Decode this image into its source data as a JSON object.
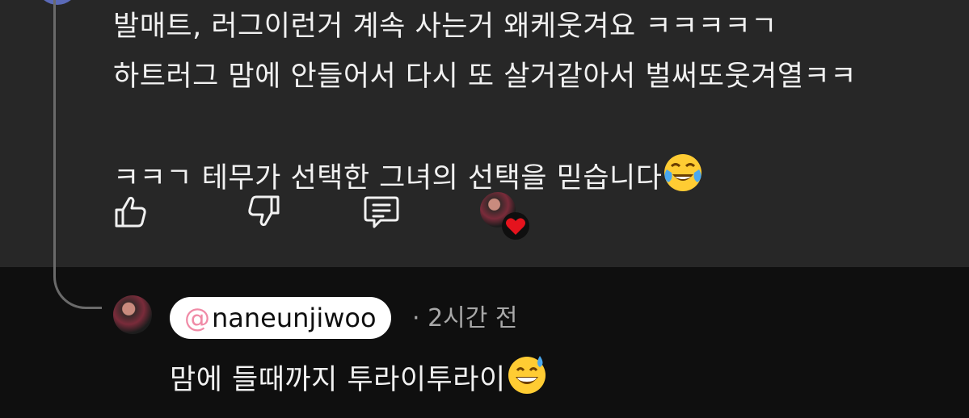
{
  "comment": {
    "lines": [
      "발매트, 러그이런거 계속 사는거 왜케웃겨요 ㅋㅋㅋㅋㄱ",
      "하트러그 맘에 안들어서 다시 또 살거같아서 벌써또웃겨열ㅋㅋ",
      "ㅋㅋㄱ 테무가 선택한 그녀의 선택을 믿습니다"
    ],
    "end_emoji": "face-with-tears-of-joy"
  },
  "actions": {
    "like_icon": "thumbs-up-icon",
    "dislike_icon": "thumbs-down-icon",
    "reply_icon": "comment-icon",
    "creator_heart": "creator-heart-avatar"
  },
  "reply": {
    "mention_handle": "naneunjiwoo",
    "mention_at": "@",
    "meta": "· 2시간 전",
    "text": "맘에 들때까지 투라이투라이",
    "end_emoji": "grinning-face-with-sweat"
  },
  "colors": {
    "comment_bg": "#272727",
    "reply_bg": "#0f0f0f",
    "text": "#f1f1f1",
    "meta": "#a8a8a8",
    "heart": "#e5131d"
  }
}
